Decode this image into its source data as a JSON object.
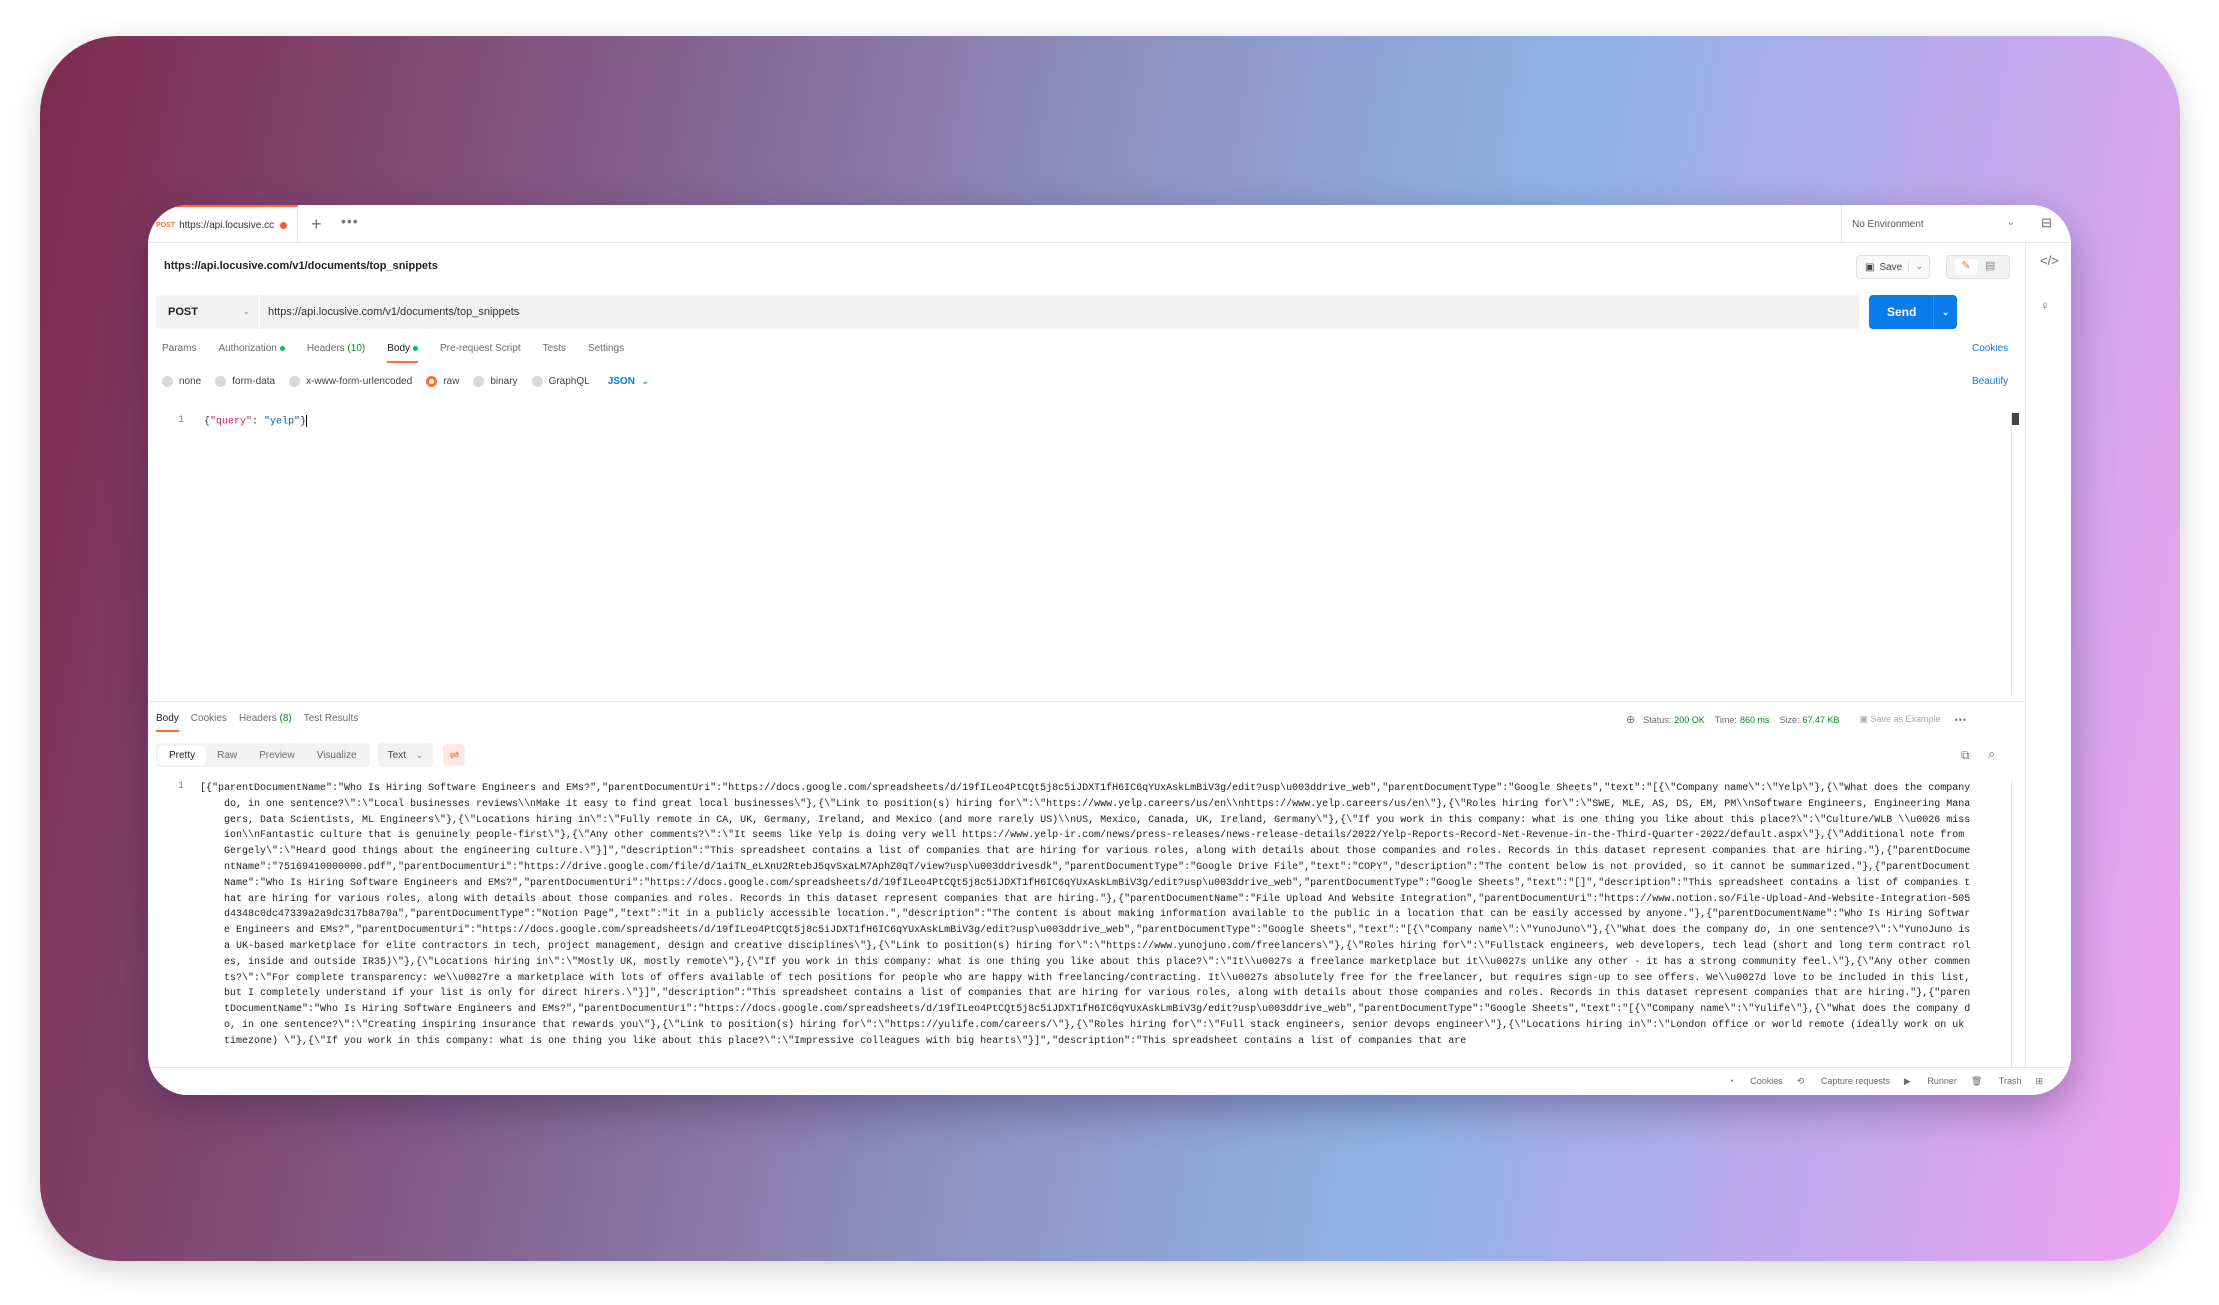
{
  "tab": {
    "method": "POST",
    "title": "https://api.locusive.cc"
  },
  "environment": {
    "label": "No Environment"
  },
  "request": {
    "title": "https://api.locusive.com/v1/documents/top_snippets",
    "method": "POST",
    "url": "https://api.locusive.com/v1/documents/top_snippets",
    "send_label": "Send",
    "save_label": "Save"
  },
  "request_tabs": [
    {
      "label": "Params"
    },
    {
      "label": "Authorization"
    },
    {
      "label": "Headers",
      "count": "(10)"
    },
    {
      "label": "Body"
    },
    {
      "label": "Pre-request Script"
    },
    {
      "label": "Tests"
    },
    {
      "label": "Settings"
    }
  ],
  "cookies_link": "Cookies",
  "body_types": [
    "none",
    "form-data",
    "x-www-form-urlencoded",
    "raw",
    "binary",
    "GraphQL"
  ],
  "body_format": "JSON",
  "beautify_label": "Beautify",
  "editor": {
    "line_number": "1",
    "key": "\"query\"",
    "value": "\"yelp\""
  },
  "response_tabs": [
    {
      "label": "Body"
    },
    {
      "label": "Cookies"
    },
    {
      "label": "Headers",
      "count": "(8)"
    },
    {
      "label": "Test Results"
    }
  ],
  "response_meta": {
    "status_label": "Status:",
    "status_value": "200 OK",
    "time_label": "Time:",
    "time_value": "860 ms",
    "size_label": "Size:",
    "size_value": "67.47 KB",
    "save_example": "Save as Example"
  },
  "view_modes": [
    "Pretty",
    "Raw",
    "Preview",
    "Visualize"
  ],
  "view_format": "Text",
  "response_body": {
    "line_number": "1",
    "text": "[{\"parentDocumentName\":\"Who Is Hiring Software Engineers and EMs?\",\"parentDocumentUri\":\"https://docs.google.com/spreadsheets/d/19fILeo4PtCQt5j8c5iJDXT1fH6IC6qYUxAskLmBiV3g/edit?usp\\u003ddrive_web\",\"parentDocumentType\":\"Google Sheets\",\"text\":\"[{\\\"Company name\\\":\\\"Yelp\\\"},{\\\"What does the company do, in one sentence?\\\":\\\"Local businesses reviews\\\\nMake it easy to find great local businesses\\\"},{\\\"Link to position(s) hiring for\\\":\\\"https://www.yelp.careers/us/en\\\\nhttps://www.yelp.careers/us/en\\\"},{\\\"Roles hiring for\\\":\\\"SWE, MLE, AS, DS, EM, PM\\\\nSoftware Engineers, Engineering Managers, Data Scientists, ML Engineers\\\"},{\\\"Locations hiring in\\\":\\\"Fully remote in CA, UK, Germany, Ireland, and Mexico (and more rarely US)\\\\nUS, Mexico, Canada, UK, Ireland, Germany\\\"},{\\\"If you work in this company: what is one thing you like about this place?\\\":\\\"Culture/WLB \\\\u0026 mission\\\\nFantastic culture that is genuinely people-first\\\"},{\\\"Any other comments?\\\":\\\"It seems like Yelp is doing very well https://www.yelp-ir.com/news/press-releases/news-release-details/2022/Yelp-Reports-Record-Net-Revenue-in-the-Third-Quarter-2022/default.aspx\\\"},{\\\"Additional note from Gergely\\\":\\\"Heard good things about the engineering culture.\\\"}]\",\"description\":\"This spreadsheet contains a list of companies that are hiring for various roles, along with details about those companies and roles. Records in this dataset represent companies that are hiring.\"},{\"parentDocumentName\":\"75169410000000.pdf\",\"parentDocumentUri\":\"https://drive.google.com/file/d/1aiTN_eLXnU2RtebJ5qvSxaLM7AphZ0qT/view?usp\\u003ddrivesdk\",\"parentDocumentType\":\"Google Drive File\",\"text\":\"COPY\",\"description\":\"The content below is not provided, so it cannot be summarized.\"},{\"parentDocumentName\":\"Who Is Hiring Software Engineers and EMs?\",\"parentDocumentUri\":\"https://docs.google.com/spreadsheets/d/19fILeo4PtCQt5j8c5iJDXT1fH6IC6qYUxAskLmBiV3g/edit?usp\\u003ddrive_web\",\"parentDocumentType\":\"Google Sheets\",\"text\":\"[]\",\"description\":\"This spreadsheet contains a list of companies that are hiring for various roles, along with details about those companies and roles. Records in this dataset represent companies that are hiring.\"},{\"parentDocumentName\":\"File Upload And Website Integration\",\"parentDocumentUri\":\"https://www.notion.so/File-Upload-And-Website-Integration-505d4348c0dc47339a2a9dc317b8a70a\",\"parentDocumentType\":\"Notion Page\",\"text\":\"it in a publicly accessible location.\",\"description\":\"The content is about making information available to the public in a location that can be easily accessed by anyone.\"},{\"parentDocumentName\":\"Who Is Hiring Software Engineers and EMs?\",\"parentDocumentUri\":\"https://docs.google.com/spreadsheets/d/19fILeo4PtCQt5j8c5iJDXT1fH6IC6qYUxAskLmBiV3g/edit?usp\\u003ddrive_web\",\"parentDocumentType\":\"Google Sheets\",\"text\":\"[{\\\"Company name\\\":\\\"YunoJuno\\\"},{\\\"What does the company do, in one sentence?\\\":\\\"YunoJuno is a UK-based marketplace for elite contractors in tech, project management, design and creative disciplines\\\"},{\\\"Link to position(s) hiring for\\\":\\\"https://www.yunojuno.com/freelancers\\\"},{\\\"Roles hiring for\\\":\\\"Fullstack engineers, web developers, tech lead (short and long term contract roles, inside and outside IR35)\\\"},{\\\"Locations hiring in\\\":\\\"Mostly UK, mostly remote\\\"},{\\\"If you work in this company: what is one thing you like about this place?\\\":\\\"It\\\\u0027s a freelance marketplace but it\\\\u0027s unlike any other - it has a strong community feel.\\\"},{\\\"Any other comments?\\\":\\\"For complete transparency: we\\\\u0027re a marketplace with lots of offers available of tech positions for people who are happy with freelancing/contracting. It\\\\u0027s absolutely free for the freelancer, but requires sign-up to see offers. We\\\\u0027d love to be included in this list, but I completely understand if your list is only for direct hirers.\\\"}]\",\"description\":\"This spreadsheet contains a list of companies that are hiring for various roles, along with details about those companies and roles. Records in this dataset represent companies that are hiring.\"},{\"parentDocumentName\":\"Who Is Hiring Software Engineers and EMs?\",\"parentDocumentUri\":\"https://docs.google.com/spreadsheets/d/19fILeo4PtCQt5j8c5iJDXT1fH6IC6qYUxAskLmBiV3g/edit?usp\\u003ddrive_web\",\"parentDocumentType\":\"Google Sheets\",\"text\":\"[{\\\"Company name\\\":\\\"Yulife\\\"},{\\\"What does the company do, in one sentence?\\\":\\\"Creating inspiring insurance that rewards you\\\"},{\\\"Link to position(s) hiring for\\\":\\\"https://yulife.com/careers/\\\"},{\\\"Roles hiring for\\\":\\\"Full stack engineers, senior devops engineer\\\"},{\\\"Locations hiring in\\\":\\\"London office or world remote (ideally work on uk timezone) \\\"},{\\\"If you work in this company: what is one thing you like about this place?\\\":\\\"Impressive colleagues with big hearts\\\"}]\",\"description\":\"This spreadsheet contains a list of companies that are"
  },
  "status_bar": [
    "Cookies",
    "Capture requests",
    "Runner",
    "Trash"
  ],
  "colors": {
    "accent": "#ff6c37",
    "primary": "#097bed",
    "success": "#0c8a1f"
  }
}
